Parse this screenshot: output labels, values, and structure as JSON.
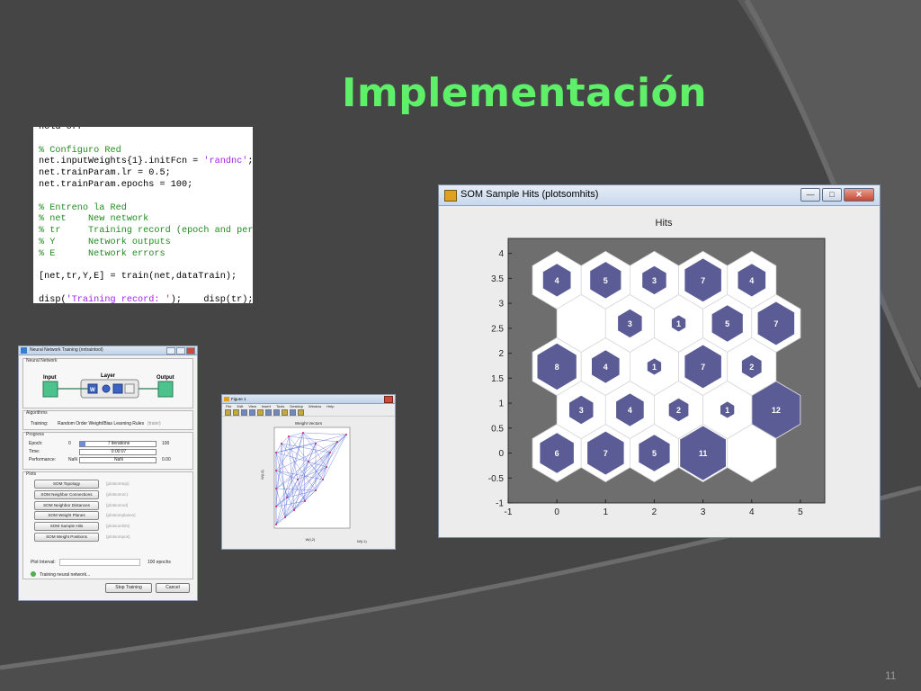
{
  "slide": {
    "title": "Implementación",
    "number": "11"
  },
  "colors": {
    "title": "#5ff06a",
    "background": "#454545",
    "hex_fill": "#5b5b96",
    "plot_bg": "#6e6e6e"
  },
  "code_snippet": {
    "lines": [
      {
        "kind": "code",
        "text": "hold off"
      },
      {
        "kind": "blank",
        "text": ""
      },
      {
        "kind": "comment",
        "text": "% Configuro Red"
      },
      {
        "kind": "code_str",
        "text": "net.inputWeights{1}.initFcn = ",
        "str": "'randnc'",
        "tail": ";"
      },
      {
        "kind": "code",
        "text": "net.trainParam.lr = 0.5;"
      },
      {
        "kind": "code",
        "text": "net.trainParam.epochs = 100;"
      },
      {
        "kind": "blank",
        "text": ""
      },
      {
        "kind": "comment",
        "text": "% Entreno la Red"
      },
      {
        "kind": "comment",
        "text": "% net    New network"
      },
      {
        "kind": "comment",
        "text": "% tr     Training record (epoch and perf)"
      },
      {
        "kind": "comment",
        "text": "% Y      Network outputs"
      },
      {
        "kind": "comment",
        "text": "% E      Network errors"
      },
      {
        "kind": "blank",
        "text": ""
      },
      {
        "kind": "code",
        "text": "[net,tr,Y,E] = train(net,dataTrain);"
      },
      {
        "kind": "blank",
        "text": ""
      },
      {
        "kind": "code_str",
        "text": "disp(",
        "str": "'Training record: '",
        "tail": ");    disp(tr);"
      }
    ]
  },
  "nntool_window": {
    "title": "Neural Network Training (nntraintool)",
    "sections": {
      "network": "Neural Network",
      "algorithms": "Algorithms",
      "progress": "Progress",
      "plots": "Plots"
    },
    "diagram": {
      "input": "Input",
      "layer": "Layer",
      "output": "Output",
      "w": "W",
      "b": "b"
    },
    "training_label": "Training:",
    "training_value": "Random Order Weight/Bias Learning Rules",
    "training_fn": "(trainr)",
    "progress_rows": [
      {
        "label": "Epoch:",
        "start": "0",
        "current": "7 iterations",
        "end": "100",
        "fill": 0.07
      },
      {
        "label": "Time:",
        "start": "",
        "current": "0:00:07",
        "end": "",
        "fill": 0
      },
      {
        "label": "Performance:",
        "start": "NaN",
        "current": "NaN",
        "end": "0.00",
        "fill": 0
      }
    ],
    "plot_buttons": [
      {
        "label": "SOM Topology",
        "cmd": "(plotsomtop)"
      },
      {
        "label": "SOM Neighbor Connections",
        "cmd": "(plotsomnc)"
      },
      {
        "label": "SOM Neighbor Distances",
        "cmd": "(plotsomnd)"
      },
      {
        "label": "SOM Weight Planes",
        "cmd": "(plotsomplanes)"
      },
      {
        "label": "SOM Sample Hits",
        "cmd": "(plotsomhits)"
      },
      {
        "label": "SOM Weight Positions",
        "cmd": "(plotsompos)"
      }
    ],
    "plot_interval_label": "Plot Interval:",
    "plot_interval_value": "100 epochs",
    "status": "Training neural network...",
    "stop_button": "Stop Training",
    "cancel_button": "Cancel"
  },
  "figure_window": {
    "title": "Figure 1",
    "menu": [
      "File",
      "Edit",
      "View",
      "Insert",
      "Tools",
      "Desktop",
      "Window",
      "Help"
    ],
    "plot_title": "Weight Vectors",
    "xlabel": "W(i,2)",
    "ylabel": "W(i,3)",
    "xlabel2": "W(i,1)"
  },
  "som_window": {
    "title": "SOM Sample Hits (plotsomhits)",
    "window_buttons": {
      "minimize": "—",
      "maximize": "□",
      "close": "✕"
    }
  },
  "chart_data": {
    "type": "heatmap",
    "title": "Hits",
    "xlabel": "",
    "ylabel": "",
    "xlim": [
      -1,
      5.5
    ],
    "ylim": [
      -1,
      4.3
    ],
    "xticks": [
      "-1",
      "0",
      "1",
      "2",
      "3",
      "4",
      "5"
    ],
    "yticks": [
      "-1",
      "-0.5",
      "0",
      "0.5",
      "1",
      "1.5",
      "2",
      "2.5",
      "3",
      "3.5",
      "4"
    ],
    "max_hits": 12,
    "cells": [
      {
        "x": 0,
        "y": 0,
        "hits": 6
      },
      {
        "x": 1,
        "y": 0,
        "hits": 7
      },
      {
        "x": 2,
        "y": 0,
        "hits": 5
      },
      {
        "x": 3,
        "y": 0,
        "hits": 11
      },
      {
        "x": 4,
        "y": 0,
        "hits": 0
      },
      {
        "x": 0.5,
        "y": 0.866,
        "hits": 3
      },
      {
        "x": 1.5,
        "y": 0.866,
        "hits": 4
      },
      {
        "x": 2.5,
        "y": 0.866,
        "hits": 2
      },
      {
        "x": 3.5,
        "y": 0.866,
        "hits": 1
      },
      {
        "x": 4.5,
        "y": 0.866,
        "hits": 12
      },
      {
        "x": 0,
        "y": 1.732,
        "hits": 8
      },
      {
        "x": 1,
        "y": 1.732,
        "hits": 4
      },
      {
        "x": 2,
        "y": 1.732,
        "hits": 1
      },
      {
        "x": 3,
        "y": 1.732,
        "hits": 7
      },
      {
        "x": 4,
        "y": 1.732,
        "hits": 2
      },
      {
        "x": 0.5,
        "y": 2.598,
        "hits": 0
      },
      {
        "x": 1.5,
        "y": 2.598,
        "hits": 3
      },
      {
        "x": 2.5,
        "y": 2.598,
        "hits": 1
      },
      {
        "x": 3.5,
        "y": 2.598,
        "hits": 5
      },
      {
        "x": 4.5,
        "y": 2.598,
        "hits": 7
      },
      {
        "x": 0,
        "y": 3.464,
        "hits": 4
      },
      {
        "x": 1,
        "y": 3.464,
        "hits": 5
      },
      {
        "x": 2,
        "y": 3.464,
        "hits": 3
      },
      {
        "x": 3,
        "y": 3.464,
        "hits": 7
      },
      {
        "x": 4,
        "y": 3.464,
        "hits": 4
      }
    ]
  }
}
